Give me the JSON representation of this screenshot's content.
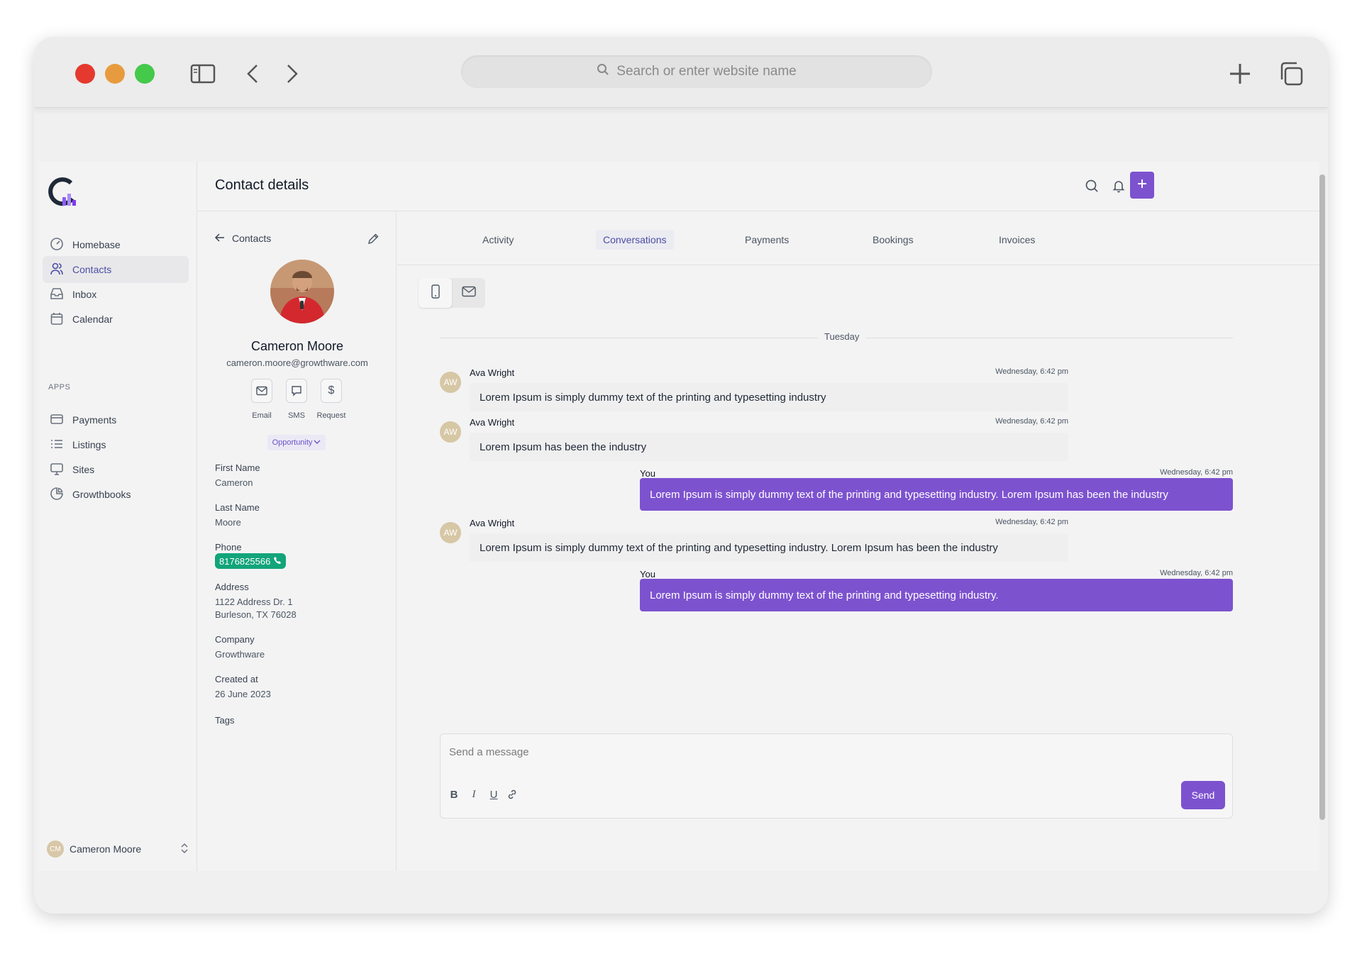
{
  "browser": {
    "search_placeholder": "Search or enter website name"
  },
  "sidebar": {
    "items": [
      {
        "label": "Homebase",
        "icon": "gauge-icon"
      },
      {
        "label": "Contacts",
        "icon": "users-icon"
      },
      {
        "label": "Inbox",
        "icon": "inbox-icon"
      },
      {
        "label": "Calendar",
        "icon": "calendar-icon"
      }
    ],
    "apps_label": "APPS",
    "apps": [
      {
        "label": "Payments",
        "icon": "card-icon"
      },
      {
        "label": "Listings",
        "icon": "list-icon"
      },
      {
        "label": "Sites",
        "icon": "monitor-icon"
      },
      {
        "label": "Growthbooks",
        "icon": "chart-icon"
      }
    ],
    "user": {
      "initials": "CM",
      "name": "Cameron Moore"
    }
  },
  "header": {
    "title": "Contact details"
  },
  "profile": {
    "back_label": "Contacts",
    "name": "Cameron Moore",
    "email": "cameron.moore@growthware.com",
    "actions": [
      {
        "label": "Email",
        "icon": "mail-icon"
      },
      {
        "label": "SMS",
        "icon": "chat-icon"
      },
      {
        "label": "Request",
        "icon": "dollar-icon"
      }
    ],
    "opportunity_label": "Opportunity",
    "fields": {
      "first_name_label": "First Name",
      "first_name": "Cameron",
      "last_name_label": "Last Name",
      "last_name": "Moore",
      "phone_label": "Phone",
      "phone": "8176825566",
      "address_label": "Address",
      "address_line1": "1122 Address Dr. 1",
      "address_line2": "Burleson, TX 76028",
      "company_label": "Company",
      "company": "Growthware",
      "created_label": "Created at",
      "created": "26 June 2023",
      "tags_label": "Tags"
    }
  },
  "tabs": [
    "Activity",
    "Conversations",
    "Payments",
    "Bookings",
    "Invoices"
  ],
  "active_tab": "Conversations",
  "conversation": {
    "day_label": "Tuesday",
    "messages": [
      {
        "direction": "in",
        "sender": "Ava Wright",
        "initials": "AW",
        "time": "Wednesday, 6:42 pm",
        "text": "Lorem Ipsum is simply dummy text of the printing and typesetting industry"
      },
      {
        "direction": "in",
        "sender": "Ava Wright",
        "initials": "AW",
        "time": "Wednesday, 6:42 pm",
        "text": "Lorem Ipsum has been the industry"
      },
      {
        "direction": "out",
        "sender": "You",
        "time": "Wednesday, 6:42 pm",
        "text": "Lorem Ipsum is simply dummy text of the printing and typesetting industry. Lorem Ipsum has been the industry"
      },
      {
        "direction": "in",
        "sender": "Ava Wright",
        "initials": "AW",
        "time": "Wednesday, 6:42 pm",
        "text": "Lorem Ipsum is simply dummy text of the printing and typesetting industry. Lorem Ipsum has been the industry"
      },
      {
        "direction": "out",
        "sender": "You",
        "time": "Wednesday, 6:42 pm",
        "text": "Lorem Ipsum is simply dummy text of the printing and typesetting industry."
      }
    ]
  },
  "composer": {
    "placeholder": "Send a message",
    "send_label": "Send",
    "format_buttons": [
      "B",
      "I",
      "U"
    ]
  },
  "colors": {
    "accent": "#7d52cf",
    "phone_chip": "#12a47a"
  }
}
